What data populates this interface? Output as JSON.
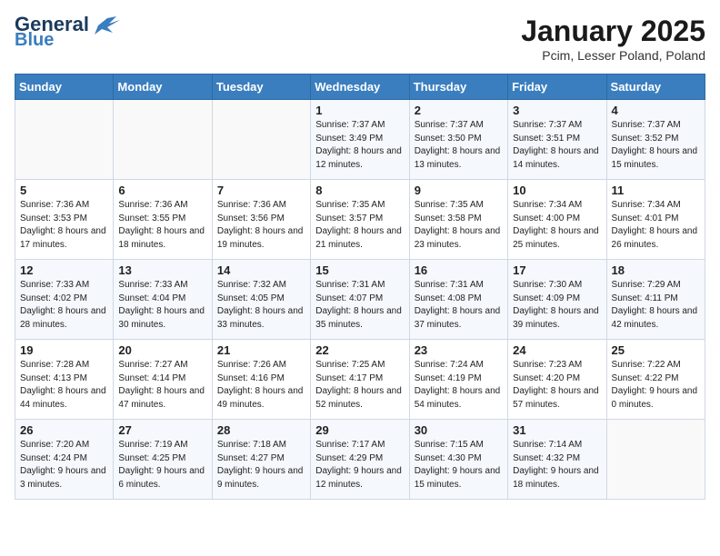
{
  "logo": {
    "general": "General",
    "blue": "Blue"
  },
  "title": "January 2025",
  "subtitle": "Pcim, Lesser Poland, Poland",
  "days_of_week": [
    "Sunday",
    "Monday",
    "Tuesday",
    "Wednesday",
    "Thursday",
    "Friday",
    "Saturday"
  ],
  "weeks": [
    [
      {
        "day": "",
        "info": ""
      },
      {
        "day": "",
        "info": ""
      },
      {
        "day": "",
        "info": ""
      },
      {
        "day": "1",
        "info": "Sunrise: 7:37 AM\nSunset: 3:49 PM\nDaylight: 8 hours\nand 12 minutes."
      },
      {
        "day": "2",
        "info": "Sunrise: 7:37 AM\nSunset: 3:50 PM\nDaylight: 8 hours\nand 13 minutes."
      },
      {
        "day": "3",
        "info": "Sunrise: 7:37 AM\nSunset: 3:51 PM\nDaylight: 8 hours\nand 14 minutes."
      },
      {
        "day": "4",
        "info": "Sunrise: 7:37 AM\nSunset: 3:52 PM\nDaylight: 8 hours\nand 15 minutes."
      }
    ],
    [
      {
        "day": "5",
        "info": "Sunrise: 7:36 AM\nSunset: 3:53 PM\nDaylight: 8 hours\nand 17 minutes."
      },
      {
        "day": "6",
        "info": "Sunrise: 7:36 AM\nSunset: 3:55 PM\nDaylight: 8 hours\nand 18 minutes."
      },
      {
        "day": "7",
        "info": "Sunrise: 7:36 AM\nSunset: 3:56 PM\nDaylight: 8 hours\nand 19 minutes."
      },
      {
        "day": "8",
        "info": "Sunrise: 7:35 AM\nSunset: 3:57 PM\nDaylight: 8 hours\nand 21 minutes."
      },
      {
        "day": "9",
        "info": "Sunrise: 7:35 AM\nSunset: 3:58 PM\nDaylight: 8 hours\nand 23 minutes."
      },
      {
        "day": "10",
        "info": "Sunrise: 7:34 AM\nSunset: 4:00 PM\nDaylight: 8 hours\nand 25 minutes."
      },
      {
        "day": "11",
        "info": "Sunrise: 7:34 AM\nSunset: 4:01 PM\nDaylight: 8 hours\nand 26 minutes."
      }
    ],
    [
      {
        "day": "12",
        "info": "Sunrise: 7:33 AM\nSunset: 4:02 PM\nDaylight: 8 hours\nand 28 minutes."
      },
      {
        "day": "13",
        "info": "Sunrise: 7:33 AM\nSunset: 4:04 PM\nDaylight: 8 hours\nand 30 minutes."
      },
      {
        "day": "14",
        "info": "Sunrise: 7:32 AM\nSunset: 4:05 PM\nDaylight: 8 hours\nand 33 minutes."
      },
      {
        "day": "15",
        "info": "Sunrise: 7:31 AM\nSunset: 4:07 PM\nDaylight: 8 hours\nand 35 minutes."
      },
      {
        "day": "16",
        "info": "Sunrise: 7:31 AM\nSunset: 4:08 PM\nDaylight: 8 hours\nand 37 minutes."
      },
      {
        "day": "17",
        "info": "Sunrise: 7:30 AM\nSunset: 4:09 PM\nDaylight: 8 hours\nand 39 minutes."
      },
      {
        "day": "18",
        "info": "Sunrise: 7:29 AM\nSunset: 4:11 PM\nDaylight: 8 hours\nand 42 minutes."
      }
    ],
    [
      {
        "day": "19",
        "info": "Sunrise: 7:28 AM\nSunset: 4:13 PM\nDaylight: 8 hours\nand 44 minutes."
      },
      {
        "day": "20",
        "info": "Sunrise: 7:27 AM\nSunset: 4:14 PM\nDaylight: 8 hours\nand 47 minutes."
      },
      {
        "day": "21",
        "info": "Sunrise: 7:26 AM\nSunset: 4:16 PM\nDaylight: 8 hours\nand 49 minutes."
      },
      {
        "day": "22",
        "info": "Sunrise: 7:25 AM\nSunset: 4:17 PM\nDaylight: 8 hours\nand 52 minutes."
      },
      {
        "day": "23",
        "info": "Sunrise: 7:24 AM\nSunset: 4:19 PM\nDaylight: 8 hours\nand 54 minutes."
      },
      {
        "day": "24",
        "info": "Sunrise: 7:23 AM\nSunset: 4:20 PM\nDaylight: 8 hours\nand 57 minutes."
      },
      {
        "day": "25",
        "info": "Sunrise: 7:22 AM\nSunset: 4:22 PM\nDaylight: 9 hours\nand 0 minutes."
      }
    ],
    [
      {
        "day": "26",
        "info": "Sunrise: 7:20 AM\nSunset: 4:24 PM\nDaylight: 9 hours\nand 3 minutes."
      },
      {
        "day": "27",
        "info": "Sunrise: 7:19 AM\nSunset: 4:25 PM\nDaylight: 9 hours\nand 6 minutes."
      },
      {
        "day": "28",
        "info": "Sunrise: 7:18 AM\nSunset: 4:27 PM\nDaylight: 9 hours\nand 9 minutes."
      },
      {
        "day": "29",
        "info": "Sunrise: 7:17 AM\nSunset: 4:29 PM\nDaylight: 9 hours\nand 12 minutes."
      },
      {
        "day": "30",
        "info": "Sunrise: 7:15 AM\nSunset: 4:30 PM\nDaylight: 9 hours\nand 15 minutes."
      },
      {
        "day": "31",
        "info": "Sunrise: 7:14 AM\nSunset: 4:32 PM\nDaylight: 9 hours\nand 18 minutes."
      },
      {
        "day": "",
        "info": ""
      }
    ]
  ]
}
